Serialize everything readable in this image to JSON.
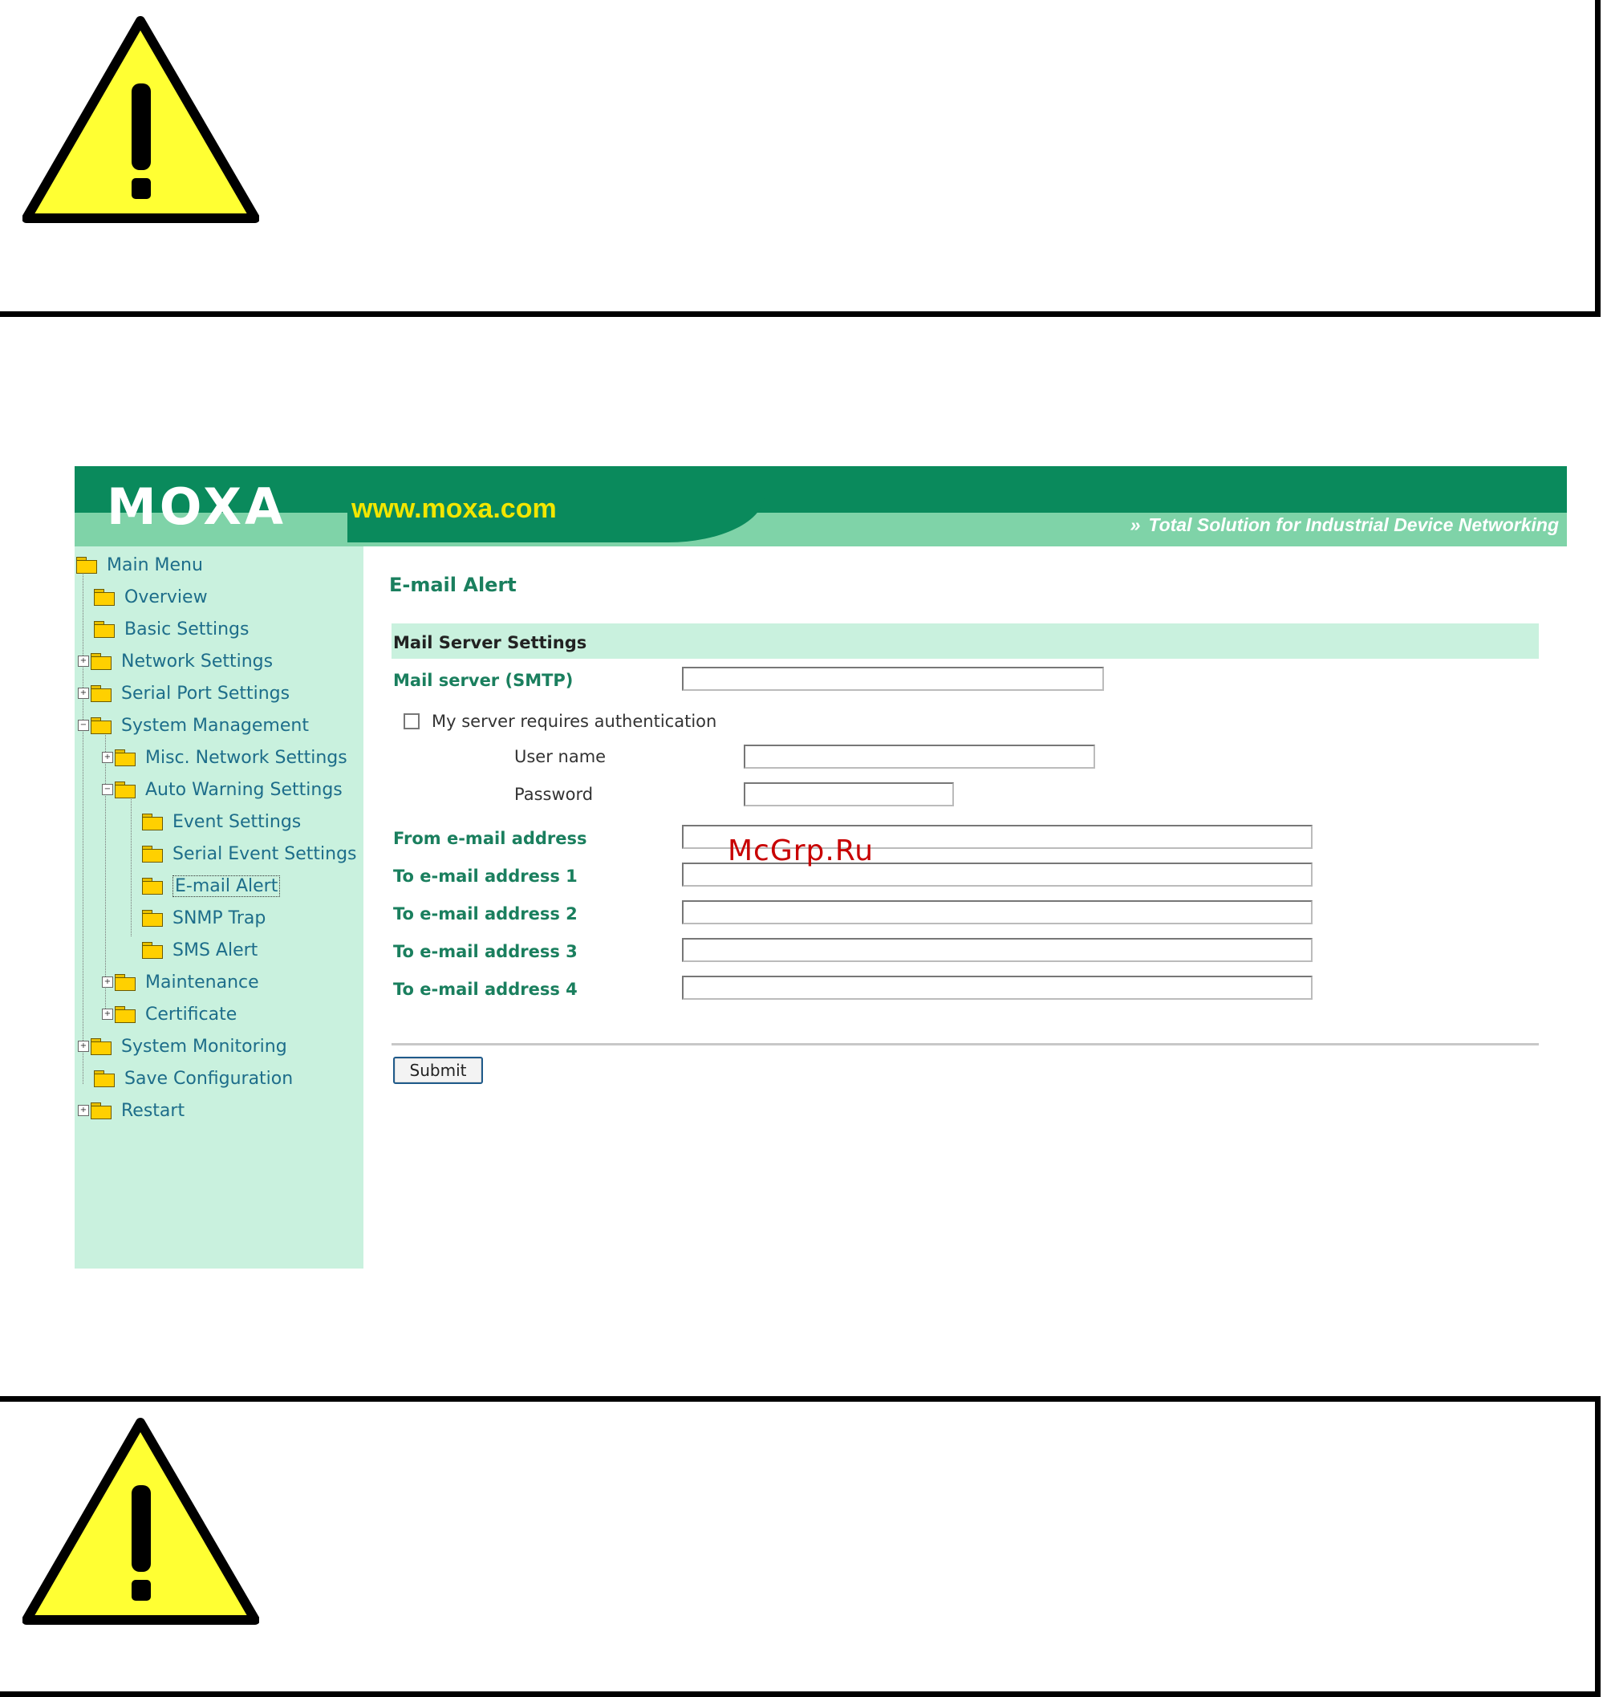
{
  "banner": {
    "logo": "MOXA",
    "website": "www.moxa.com",
    "tagline_arrows": "»",
    "tagline": "Total Solution for Industrial Device Networking"
  },
  "menu": {
    "items": [
      {
        "label": "Main Menu"
      },
      {
        "label": "Overview"
      },
      {
        "label": "Basic Settings"
      },
      {
        "label": "Network Settings"
      },
      {
        "label": "Serial Port Settings"
      },
      {
        "label": "System Management"
      },
      {
        "label": "Misc. Network Settings"
      },
      {
        "label": "Auto Warning Settings"
      },
      {
        "label": "Event Settings"
      },
      {
        "label": "Serial Event Settings"
      },
      {
        "label": "E-mail Alert"
      },
      {
        "label": "SNMP Trap"
      },
      {
        "label": "SMS Alert"
      },
      {
        "label": "Maintenance"
      },
      {
        "label": "Certificate"
      },
      {
        "label": "System Monitoring"
      },
      {
        "label": "Save Configuration"
      },
      {
        "label": "Restart"
      }
    ]
  },
  "page": {
    "title": "E-mail Alert",
    "section_title": "Mail Server Settings",
    "mail_server_label": "Mail server (SMTP)",
    "mail_server_value": "",
    "auth_checkbox_label": "My server requires authentication",
    "auth_checked": false,
    "username_label": "User name",
    "username_value": "",
    "password_label": "Password",
    "password_value": "",
    "from_label": "From e-mail address",
    "from_value": "",
    "to1_label": "To e-mail address 1",
    "to1_value": "",
    "to2_label": "To e-mail address 2",
    "to2_value": "",
    "to3_label": "To e-mail address 3",
    "to3_value": "",
    "to4_label": "To e-mail address 4",
    "to4_value": "",
    "submit_label": "Submit"
  },
  "watermark": "McGrp.Ru",
  "colors": {
    "banner_dark": "#0a8a5c",
    "banner_light": "#7fd3a8",
    "sidebar_bg": "#c9f1de",
    "label_green": "#1a7f5e",
    "website_yellow": "#f2e600",
    "warning_yellow": "#ffff33"
  }
}
